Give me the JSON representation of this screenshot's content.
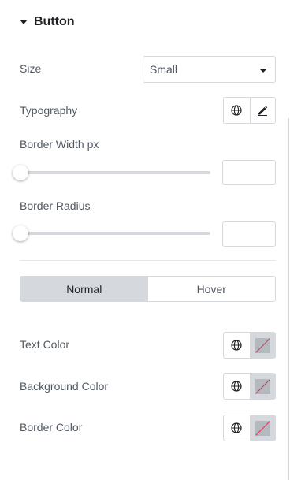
{
  "section": {
    "title": "Button"
  },
  "size": {
    "label": "Size",
    "value": "Small"
  },
  "typography": {
    "label": "Typography",
    "globe_icon": "globe-icon",
    "edit_icon": "pencil-icon"
  },
  "border_width": {
    "label": "Border Width px",
    "value": "",
    "slider_value": 0
  },
  "border_radius": {
    "label": "Border Radius",
    "value": "",
    "slider_value": 0
  },
  "tabs": {
    "normal": "Normal",
    "hover": "Hover"
  },
  "text_color": {
    "label": "Text Color"
  },
  "background_color": {
    "label": "Background Color"
  },
  "border_color": {
    "label": "Border Color"
  }
}
